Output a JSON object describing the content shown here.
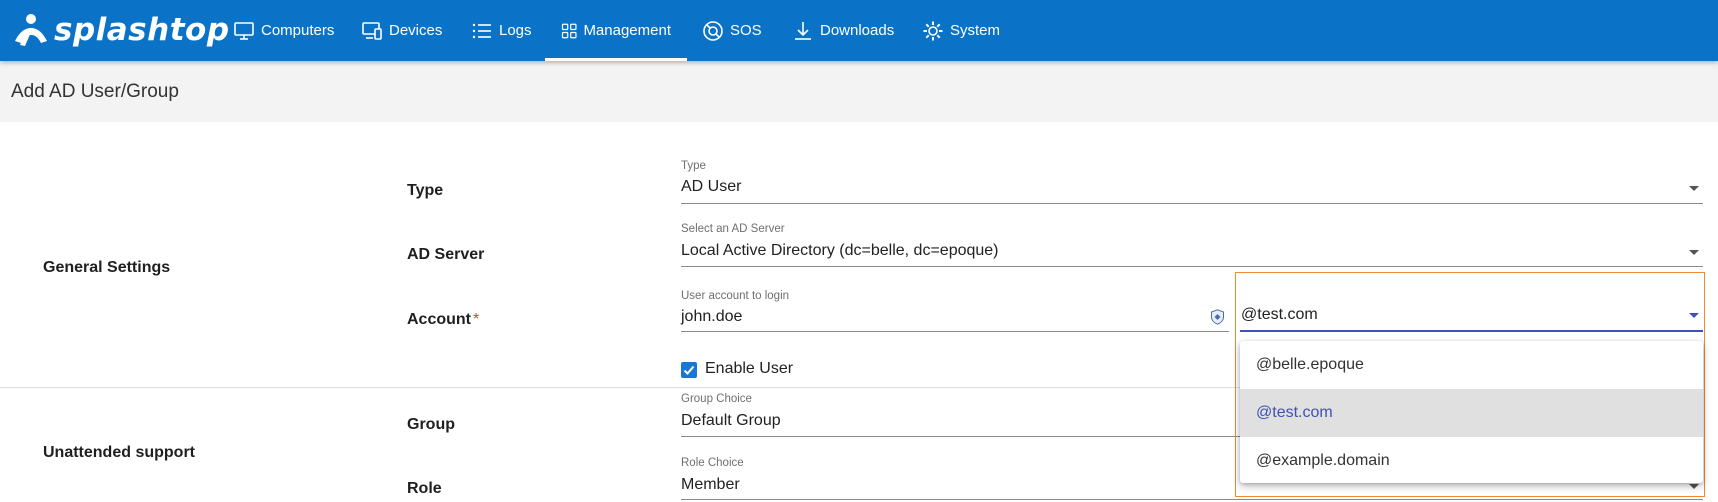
{
  "app": {
    "brand": "splashtop",
    "nav": [
      {
        "label": "Computers",
        "icon": "monitor-icon"
      },
      {
        "label": "Devices",
        "icon": "devices-icon"
      },
      {
        "label": "Logs",
        "icon": "list-icon"
      },
      {
        "label": "Management",
        "icon": "grid-icon",
        "active": true
      },
      {
        "label": "SOS",
        "icon": "sos-icon"
      },
      {
        "label": "Downloads",
        "icon": "download-icon"
      },
      {
        "label": "System",
        "icon": "gear-icon"
      }
    ],
    "colors": {
      "header": "#0a73c7",
      "accent": "#3f51b5",
      "checkbox": "#1976d2",
      "highlight_box": "#f0883a"
    }
  },
  "page": {
    "title": "Add AD User/Group"
  },
  "general": {
    "section_label": "General Settings",
    "type": {
      "label": "Type",
      "small": "Type",
      "value": "AD User"
    },
    "ad_server": {
      "label": "AD Server",
      "small": "Select an AD Server",
      "value": "Local Active Directory (dc=belle, dc=epoque)"
    },
    "account": {
      "label": "Account",
      "required_mark": "*",
      "small": "User account to login",
      "value": "john.doe"
    },
    "domain": {
      "value": "@test.com",
      "options": [
        "@belle.epoque",
        "@test.com",
        "@example.domain"
      ],
      "selected_index": 1
    },
    "enable_user": {
      "label": "Enable User",
      "checked": true
    }
  },
  "unattended": {
    "section_label": "Unattended support",
    "group": {
      "label": "Group",
      "small": "Group Choice",
      "value": "Default Group"
    },
    "role": {
      "label": "Role",
      "small": "Role Choice",
      "value": "Member"
    }
  }
}
